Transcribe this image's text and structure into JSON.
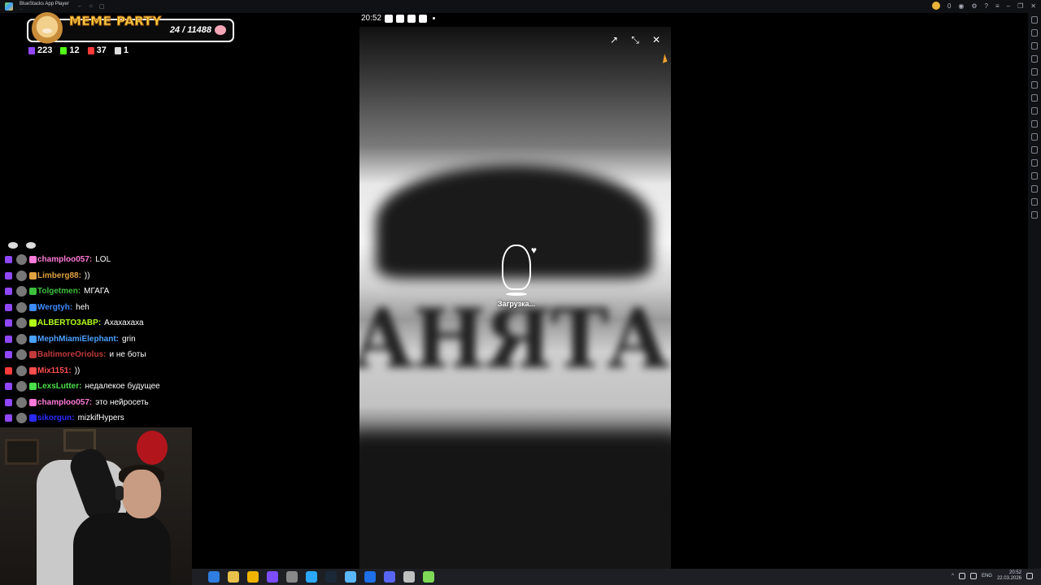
{
  "window": {
    "title": "BlueStacks App Player",
    "subtitle": "..."
  },
  "titlebar": {
    "coins": "0"
  },
  "meme_widget": {
    "title": "MEME PARTY",
    "progress": "24 / 11488"
  },
  "stats": {
    "twitch_viewers": "223",
    "kick_viewers": "12",
    "vk_viewers": "37",
    "other_viewers": "1"
  },
  "chat": {
    "messages": [
      {
        "platform": "twitch",
        "nick": "champloo057:",
        "text": "LOL",
        "color": "#ff7ad9"
      },
      {
        "platform": "twitch",
        "nick": "Limberg88:",
        "text": "))",
        "color": "#e0a040"
      },
      {
        "platform": "twitch",
        "nick": "Tolgetmen:",
        "text": "МГАГА",
        "color": "#3cbf3c"
      },
      {
        "platform": "twitch",
        "nick": "Wergtyh:",
        "text": "heh",
        "color": "#3d8bff"
      },
      {
        "platform": "twitch",
        "nick": "ALBERTO3ABP:",
        "text": "Ахахахаха",
        "color": "#b3ff1a"
      },
      {
        "platform": "twitch",
        "nick": "MephMiamiElephant:",
        "text": "grin",
        "color": "#4aa0ff"
      },
      {
        "platform": "twitch",
        "nick": "BaltimoreOriolus:",
        "text": "и не боты",
        "color": "#c23a3a"
      },
      {
        "platform": "vk",
        "nick": "Mix1151:",
        "text": "))",
        "color": "#ff4d4d"
      },
      {
        "platform": "twitch",
        "nick": "LexsLutter:",
        "text": "недалекое будущее",
        "color": "#49e049"
      },
      {
        "platform": "twitch",
        "nick": "champloo057:",
        "text": "это нейросеть",
        "color": "#ff7ad9"
      },
      {
        "platform": "twitch",
        "nick": "sikorgun:",
        "text": "mizkifHypers",
        "color": "#2a2aff"
      }
    ]
  },
  "phone": {
    "time": "20:52",
    "loading_label": "Загрузка...",
    "background_word": "АНЯТА"
  },
  "taskbar": {
    "language": "ENG",
    "clock_time": "20:52",
    "clock_date": "22.03.2026"
  },
  "colors": {
    "accent_yellow": "#f7d64b",
    "twitch_purple": "#9147ff",
    "vk_red": "#ff3b3b"
  }
}
